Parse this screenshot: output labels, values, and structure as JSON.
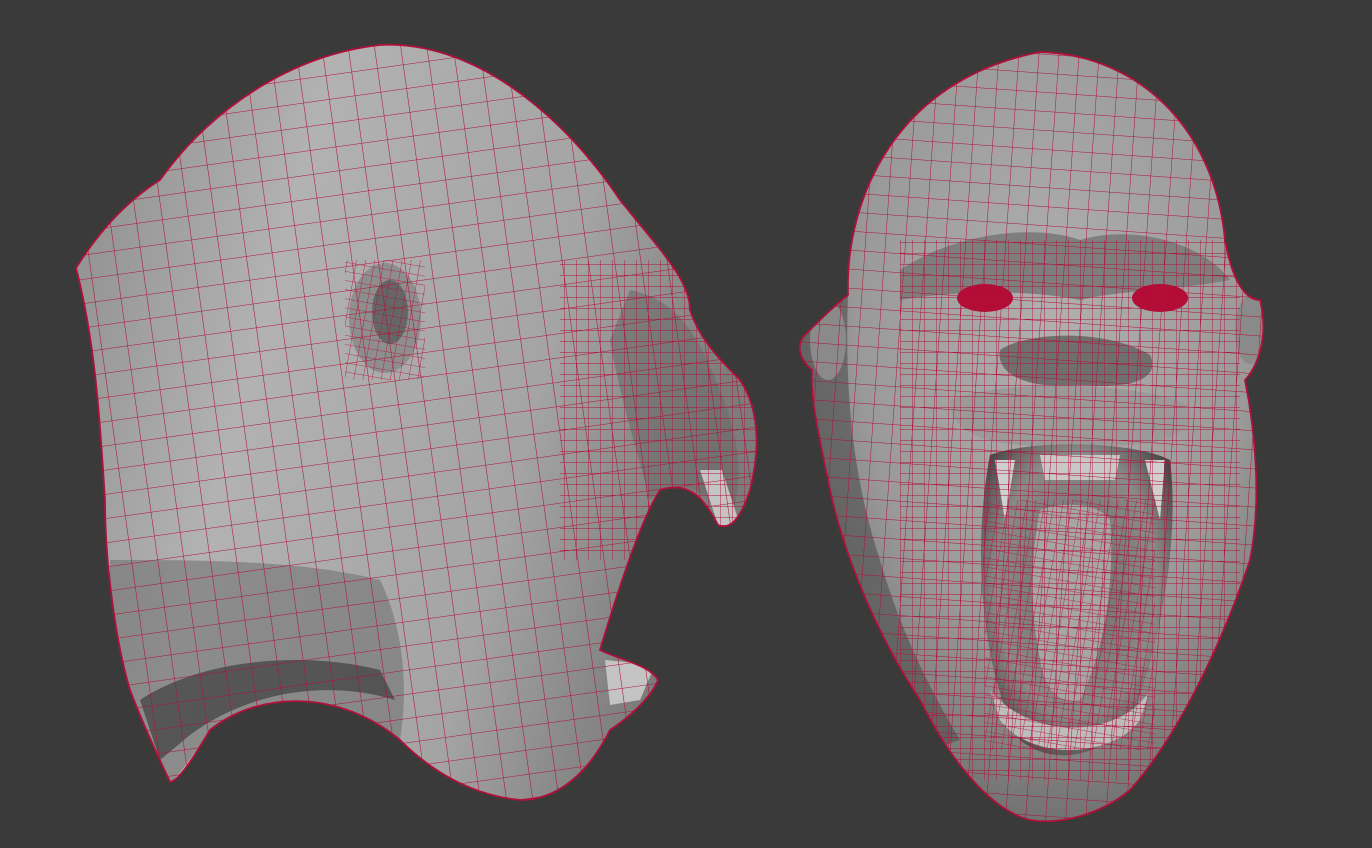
{
  "viewport": {
    "background": "#3a3a3a"
  },
  "render": {
    "mode": "wireframe-on-shaded",
    "surface_color": "#a7a7a7",
    "shadow_color": "#5e5e5e",
    "dark_color": "#1e1e1e",
    "wire_color": "#b0103a",
    "eye_color": "#b30d36"
  },
  "models": [
    {
      "name": "gorilla-head-side-view",
      "view": "side"
    },
    {
      "name": "gorilla-head-front-view",
      "view": "front"
    }
  ]
}
